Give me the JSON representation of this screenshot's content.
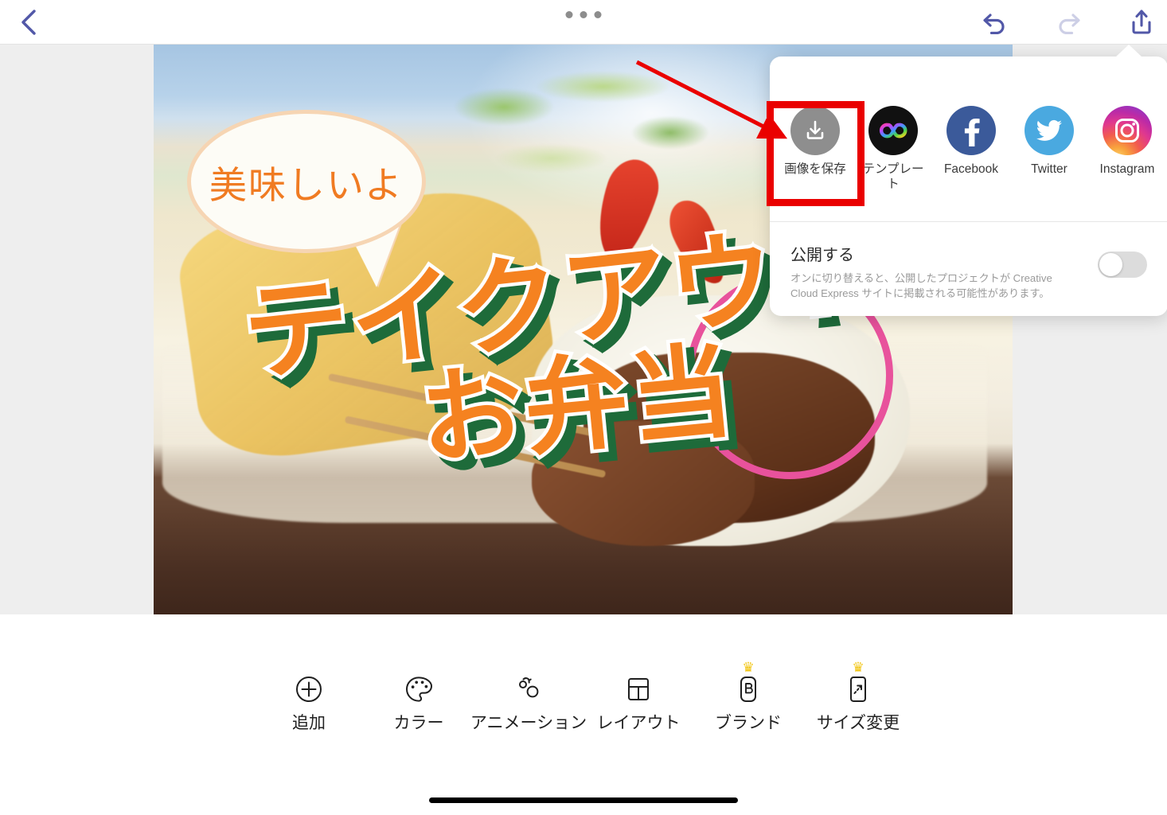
{
  "app": {
    "name": "Creative Cloud Express",
    "accent_color": "#5b5fc7",
    "annotation_color": "#ea0000"
  },
  "topbar": {
    "back_label": "‹",
    "menu_label": "•••",
    "undo_label": "undo",
    "redo_label": "redo",
    "share_label": "share"
  },
  "canvas": {
    "bubble_text": "美味しいよ",
    "title_line1": "テイクアウト",
    "title_line2": "お弁当",
    "title_fill_color": "#f58220",
    "title_outline_color": "#ffffff",
    "title_shadow_color": "#1e6b3a",
    "bubble_text_color": "#f07b22",
    "circle_color": "#e8529c"
  },
  "share_panel": {
    "items": [
      {
        "label": "画像を保存",
        "icon": "save-image-icon",
        "color": "#8e8e8e"
      },
      {
        "label": "テンプレート",
        "icon": "cc-express-template-icon",
        "color": "#111111"
      },
      {
        "label": "Facebook",
        "icon": "facebook-icon",
        "color": "#3b5a9a"
      },
      {
        "label": "Twitter",
        "icon": "twitter-icon",
        "color": "#4aa9e0"
      },
      {
        "label": "Instagram",
        "icon": "instagram-icon",
        "color": "#bc2aa6"
      }
    ],
    "publish": {
      "title": "公開する",
      "description": "オンに切り替えると、公開したプロジェクトが Creative Cloud Express サイトに掲載される可能性があります。",
      "toggle_state": "off"
    }
  },
  "toolbar": {
    "items": [
      {
        "label": "追加",
        "icon": "plus-circle-icon",
        "premium": false
      },
      {
        "label": "カラー",
        "icon": "palette-icon",
        "premium": false
      },
      {
        "label": "アニメーション",
        "icon": "animation-icon",
        "premium": false
      },
      {
        "label": "レイアウト",
        "icon": "layout-icon",
        "premium": false
      },
      {
        "label": "ブランド",
        "icon": "brand-icon",
        "premium": true
      },
      {
        "label": "サイズ変更",
        "icon": "resize-icon",
        "premium": true
      }
    ],
    "crown_glyph": "♛",
    "crown_color": "#f1c40f"
  }
}
